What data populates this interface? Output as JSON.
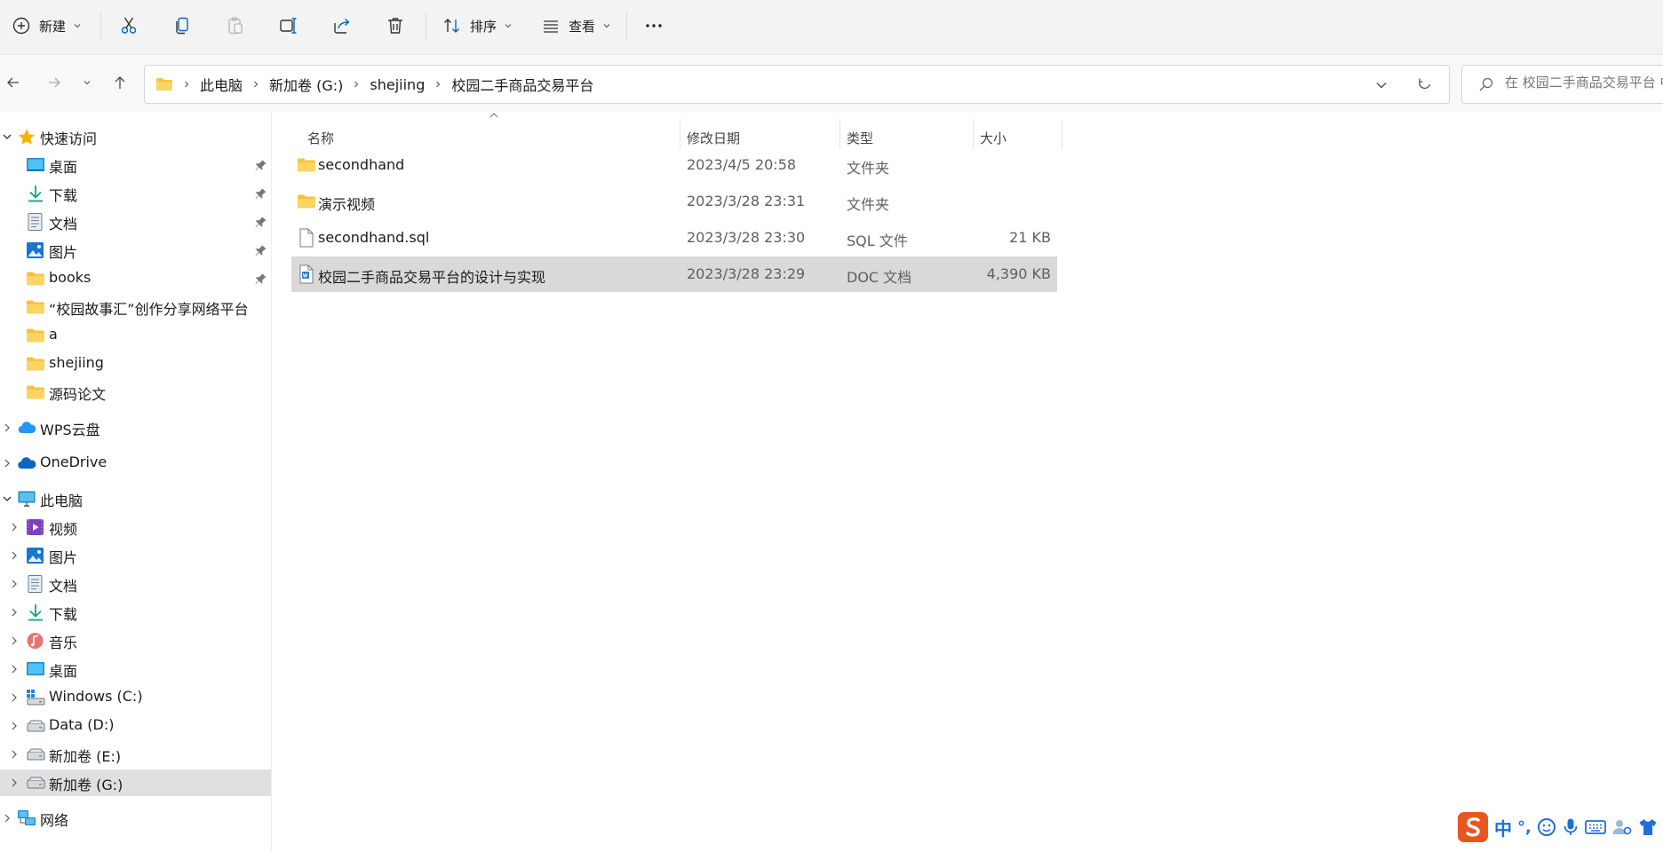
{
  "toolbar": {
    "new_label": "新建",
    "sort_label": "排序",
    "view_label": "查看"
  },
  "breadcrumb": [
    "此电脑",
    "新加卷 (G:)",
    "shejiing",
    "校园二手商品交易平台"
  ],
  "search": {
    "placeholder": "在 校园二手商品交易平台 中搜索"
  },
  "sidebar": {
    "quick_access": "快速访问",
    "quick_items": [
      {
        "label": "桌面",
        "icon": "desktop-icon",
        "pinned": true
      },
      {
        "label": "下载",
        "icon": "download-icon",
        "pinned": true
      },
      {
        "label": "文档",
        "icon": "document-icon",
        "pinned": true
      },
      {
        "label": "图片",
        "icon": "picture-icon",
        "pinned": true
      },
      {
        "label": "books",
        "icon": "folder-icon",
        "pinned": true
      },
      {
        "label": "“校园故事汇”创作分享网络平台",
        "icon": "folder-icon",
        "pinned": false
      },
      {
        "label": "a",
        "icon": "folder-icon",
        "pinned": false
      },
      {
        "label": "shejiing",
        "icon": "folder-icon",
        "pinned": false
      },
      {
        "label": "源码论文",
        "icon": "folder-icon",
        "pinned": false
      }
    ],
    "wps": "WPS云盘",
    "onedrive": "OneDrive",
    "this_pc": "此电脑",
    "pc_items": [
      {
        "label": "视频",
        "icon": "video-icon"
      },
      {
        "label": "图片",
        "icon": "picture-icon"
      },
      {
        "label": "文档",
        "icon": "document-icon"
      },
      {
        "label": "下载",
        "icon": "download-icon"
      },
      {
        "label": "音乐",
        "icon": "music-icon"
      },
      {
        "label": "桌面",
        "icon": "desktop-icon"
      },
      {
        "label": "Windows (C:)",
        "icon": "windows-drive-icon"
      },
      {
        "label": "Data (D:)",
        "icon": "drive-icon"
      },
      {
        "label": "新加卷 (E:)",
        "icon": "drive-icon"
      },
      {
        "label": "新加卷 (G:)",
        "icon": "drive-icon"
      }
    ],
    "network": "网络"
  },
  "columns": {
    "name": "名称",
    "date": "修改日期",
    "type": "类型",
    "size": "大小"
  },
  "files": [
    {
      "name": "secondhand",
      "date": "2023/4/5 20:58",
      "type": "文件夹",
      "size": "",
      "icon": "folder-icon"
    },
    {
      "name": "演示视频",
      "date": "2023/3/28 23:31",
      "type": "文件夹",
      "size": "",
      "icon": "folder-icon"
    },
    {
      "name": "secondhand.sql",
      "date": "2023/3/28 23:30",
      "type": "SQL 文件",
      "size": "21 KB",
      "icon": "file-icon"
    },
    {
      "name": "校园二手商品交易平台的设计与实现",
      "date": "2023/3/28 23:29",
      "type": "DOC 文档",
      "size": "4,390 KB",
      "icon": "wps-doc-icon"
    }
  ],
  "ime": {
    "mode": "中",
    "punct": "°,"
  },
  "colors": {
    "folder": "#f8c33b",
    "selection": "#d9d9d9",
    "accent": "#0067c0",
    "ime_logo": "#e8561f"
  }
}
